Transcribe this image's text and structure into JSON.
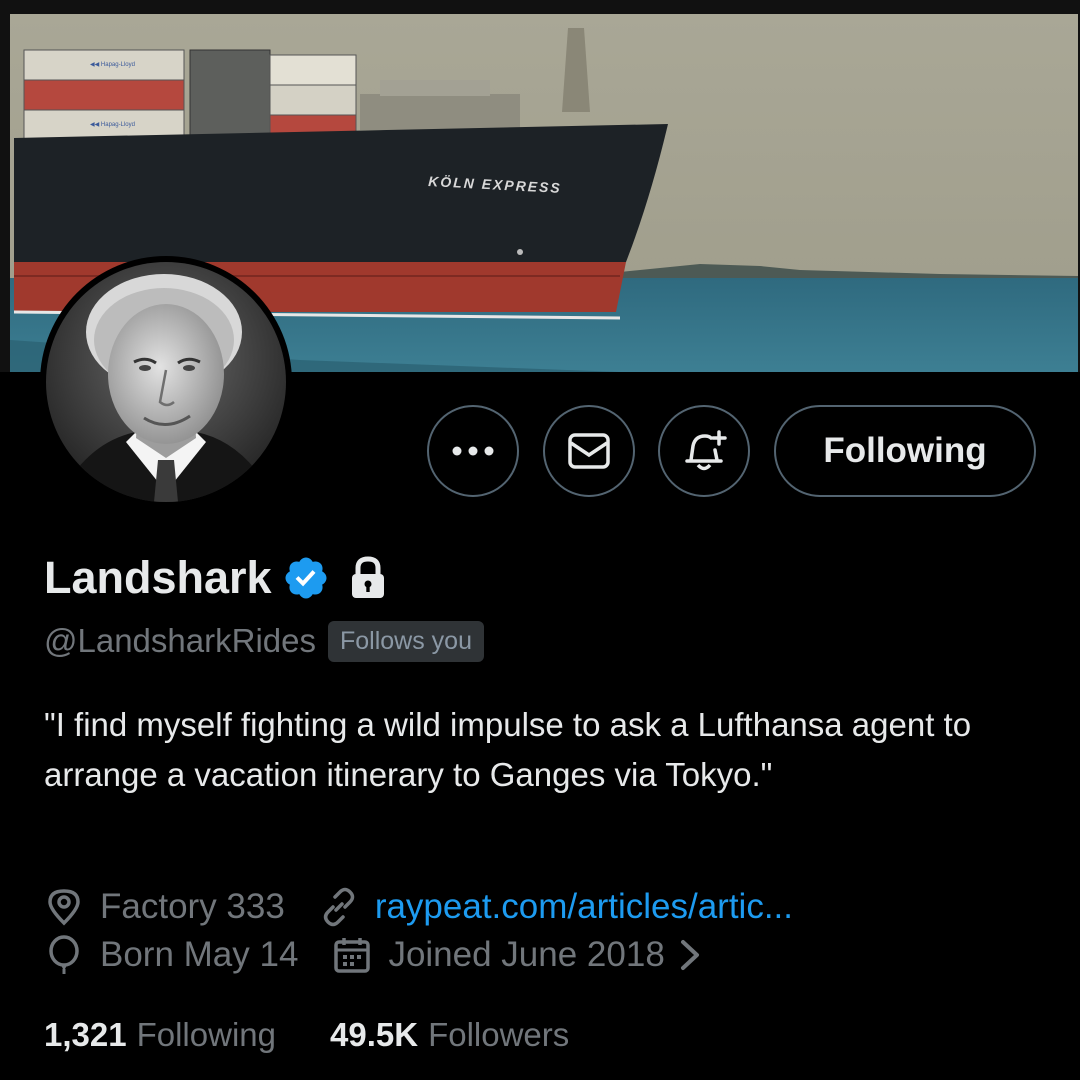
{
  "banner": {
    "ship_name": "KÖLN  EXPRESS",
    "container_brand": "Hapag-Lloyd"
  },
  "actions": {
    "more_icon": "more-horizontal-icon",
    "message_icon": "envelope-icon",
    "notify_icon": "bell-plus-icon",
    "following_label": "Following"
  },
  "profile": {
    "name": "Landshark",
    "handle": "@LandsharkRides",
    "follows_you": "Follows you",
    "bio": "\"I find myself fighting a wild impulse to ask a Lufthansa agent to arrange a vacation itinerary to Ganges via Tokyo.\"",
    "location": "Factory 333",
    "website": "raypeat.com/articles/artic...",
    "birthday": "Born May 14",
    "joined": "Joined June 2018",
    "following_count": "1,321",
    "following_label": "Following",
    "followers_count": "49.5K",
    "followers_label": "Followers"
  },
  "colors": {
    "background": "#000000",
    "text_primary": "#e7e9ea",
    "text_secondary": "#71767b",
    "link": "#1d9bf0",
    "verified": "#1d9bf0",
    "border": "#536471"
  }
}
